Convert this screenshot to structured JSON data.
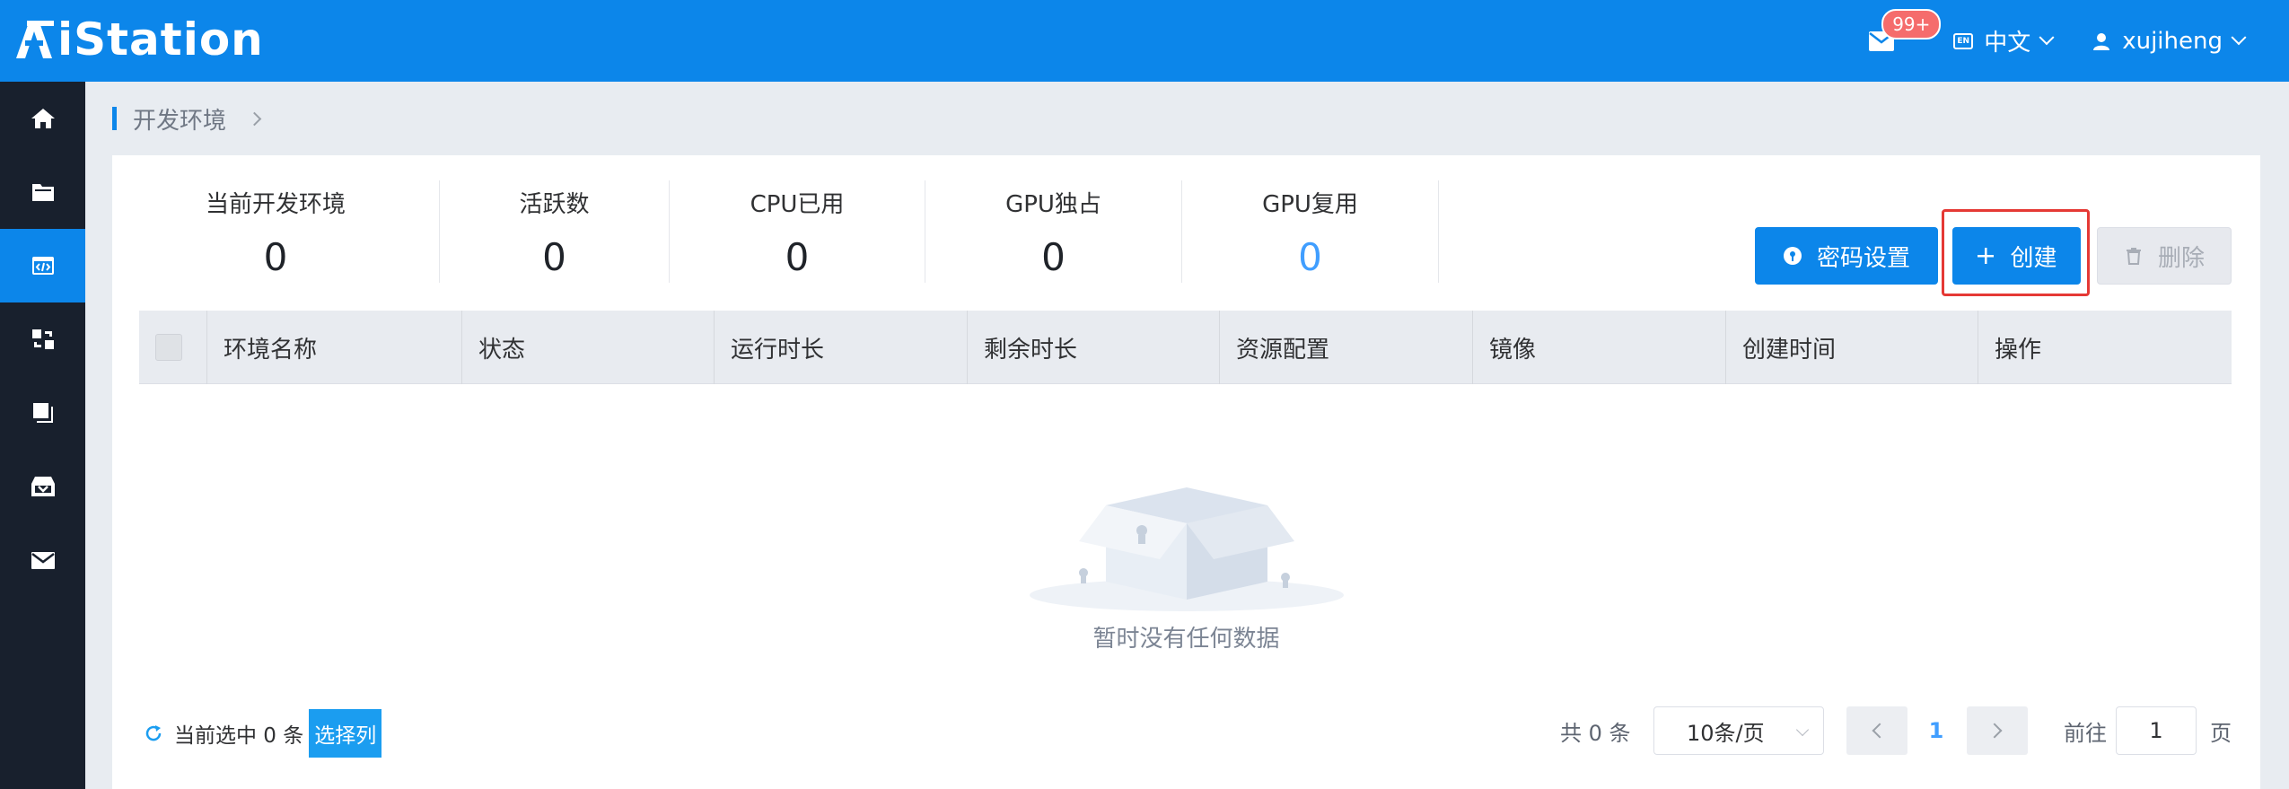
{
  "header": {
    "logo_text": "iStation",
    "logo_mark": "A",
    "mail_badge": "99+",
    "language": "中文",
    "lang_icon": "EN",
    "username": "xujiheng"
  },
  "sidebar": {
    "items": [
      {
        "icon": "home-icon"
      },
      {
        "icon": "folder-icon"
      },
      {
        "icon": "dev-env-icon",
        "active": true
      },
      {
        "icon": "transfer-icon"
      },
      {
        "icon": "copy-icon"
      },
      {
        "icon": "inbox-icon"
      },
      {
        "icon": "mail-icon"
      }
    ]
  },
  "breadcrumb": {
    "current": "开发环境"
  },
  "stats": [
    {
      "label": "当前开发环境",
      "value": "0"
    },
    {
      "label": "活跃数",
      "value": "0"
    },
    {
      "label": "CPU已用",
      "value": "0"
    },
    {
      "label": "GPU独占",
      "value": "0"
    },
    {
      "label": "GPU复用",
      "value": "0"
    }
  ],
  "toolbar": {
    "password_label": "密码设置",
    "create_label": "创建",
    "delete_label": "删除"
  },
  "table": {
    "columns": [
      "环境名称",
      "状态",
      "运行时长",
      "剩余时长",
      "资源配置",
      "镜像",
      "创建时间",
      "操作"
    ],
    "empty_text": "暂时没有任何数据"
  },
  "footer": {
    "selected_text": "当前选中 0 条",
    "select_columns": "选择列",
    "total_text": "共 0 条",
    "page_size": "10条/页",
    "current_page": "1",
    "goto_label": "前往",
    "goto_value": "1",
    "goto_suffix": "页"
  },
  "colors": {
    "primary": "#0c86ea",
    "sidebar": "#18202d",
    "badge": "#f56c6c",
    "highlight": "#e53935"
  }
}
